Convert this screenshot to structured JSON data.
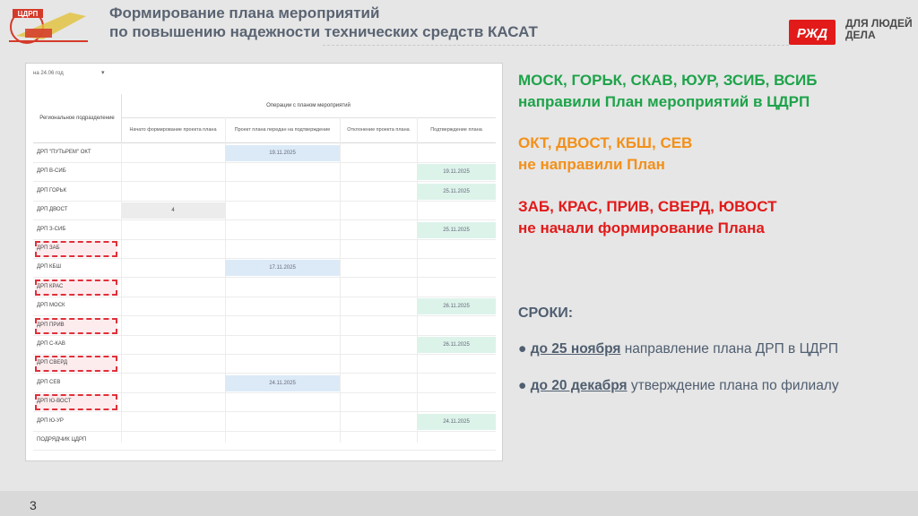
{
  "header": {
    "title_line1": "Формирование плана мероприятий",
    "title_line2": "по повышению надежности технических средств КАСАТ",
    "brand_slogan_line1": "ДЛЯ ЛЮДЕЙ",
    "brand_slogan_line2": "ДЕЛА",
    "brand_logo_text": "РЖД",
    "left_logo_text": "ЦДРП"
  },
  "table": {
    "filter_label": "на 24.06 год",
    "col_region": "Региональное подразделение",
    "col_operations": "Операции с планом мероприятий",
    "col_started": "Начато формирование проекта плана",
    "col_submitted": "Проект плана передан на подтверждение",
    "col_rejected": "Отклонение проекта плана",
    "col_confirmed": "Подтверждение плана",
    "rows": [
      {
        "name": "ДРП \"ПУТЬРЕМ\" ОКТ",
        "started": "",
        "submitted": "19.11.2025",
        "rejected": "",
        "confirmed": ""
      },
      {
        "name": "ДРП В-СИБ",
        "started": "",
        "submitted": "",
        "rejected": "",
        "confirmed": "19.11.2025"
      },
      {
        "name": "ДРП ГОРЬК",
        "started": "",
        "submitted": "",
        "rejected": "",
        "confirmed": "25.11.2025"
      },
      {
        "name": "ДРП ДВОСТ",
        "started": "4",
        "submitted": "",
        "rejected": "",
        "confirmed": ""
      },
      {
        "name": "ДРП З-СИБ",
        "started": "",
        "submitted": "",
        "rejected": "",
        "confirmed": "25.11.2025"
      },
      {
        "name": "ДРП ЗАБ",
        "started": "",
        "submitted": "",
        "rejected": "",
        "confirmed": ""
      },
      {
        "name": "ДРП КБШ",
        "started": "",
        "submitted": "17.11.2025",
        "rejected": "",
        "confirmed": ""
      },
      {
        "name": "ДРП КРАС",
        "started": "",
        "submitted": "",
        "rejected": "",
        "confirmed": ""
      },
      {
        "name": "ДРП МОСК",
        "started": "",
        "submitted": "",
        "rejected": "",
        "confirmed": "26.11.2025"
      },
      {
        "name": "ДРП ПРИВ",
        "started": "",
        "submitted": "",
        "rejected": "",
        "confirmed": ""
      },
      {
        "name": "ДРП С-КАВ",
        "started": "",
        "submitted": "",
        "rejected": "",
        "confirmed": "26.11.2025"
      },
      {
        "name": "ДРП СВЕРД",
        "started": "",
        "submitted": "",
        "rejected": "",
        "confirmed": ""
      },
      {
        "name": "ДРП СЕВ",
        "started": "",
        "submitted": "24.11.2025",
        "rejected": "",
        "confirmed": ""
      },
      {
        "name": "ДРП Ю-ВОСТ",
        "started": "",
        "submitted": "",
        "rejected": "",
        "confirmed": ""
      },
      {
        "name": "ДРП Ю-УР",
        "started": "",
        "submitted": "",
        "rejected": "",
        "confirmed": "24.11.2025"
      },
      {
        "name": "ПОДРЯДЧИК ЦДРП",
        "started": "",
        "submitted": "",
        "rejected": "",
        "confirmed": ""
      }
    ],
    "flagged_rows": [
      "ДРП ЗАБ",
      "ДРП КРАС",
      "ДРП ПРИВ",
      "ДРП СВЕРД",
      "ДРП Ю-ВОСТ"
    ]
  },
  "status": {
    "sent_line1": "МОСК, ГОРЬК, СКАВ, ЮУР, ЗСИБ, ВСИБ",
    "sent_line2": "направили План мероприятий в ЦДРП",
    "not_sent_line1": "ОКТ, ДВОСТ, КБШ, СЕВ",
    "not_sent_line2": "не направили План",
    "not_started_line1": "ЗАБ, КРАС, ПРИВ, СВЕРД, ЮВОСТ",
    "not_started_line2": "не начали формирование Плана",
    "color_sent": "#1ea34a",
    "color_not_sent": "#f39019",
    "color_not_started": "#e21a1a"
  },
  "deadlines": {
    "title": "СРОКИ:",
    "items": [
      {
        "bullet": "●",
        "date": "до 25 ноября",
        "text": " направление плана ДРП в ЦДРП"
      },
      {
        "bullet": "●",
        "date": "до 20 декабря",
        "text": " утверждение плана по филиалу"
      }
    ]
  },
  "footer": {
    "page_number": "3"
  }
}
